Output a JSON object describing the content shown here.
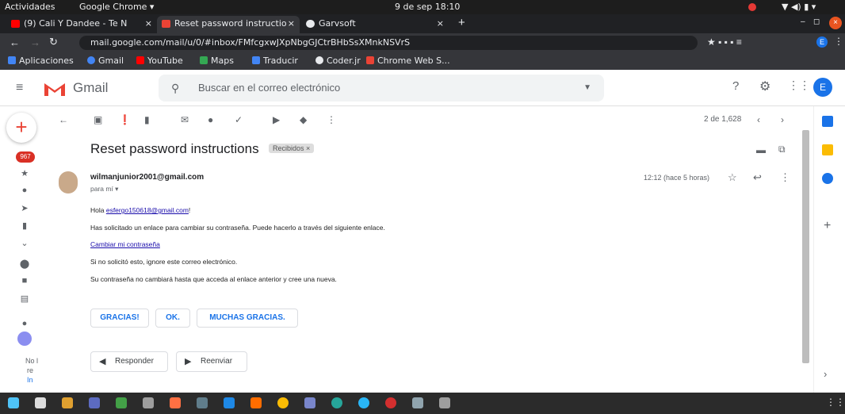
{
  "topbar": {
    "activities": "Actividades",
    "app": "Google Chrome ▾",
    "clock": "9 de sep  18:10"
  },
  "tabs": [
    {
      "title": "(9) Cali Y Dandee - Te N",
      "fav": "#ff0000"
    },
    {
      "title": "Reset password instructio",
      "fav": "#ea4335"
    },
    {
      "title": "Garvsoft",
      "fav": "#e8eaed"
    }
  ],
  "url": "mail.google.com/mail/u/0/#inbox/FMfcgxwJXpNbgGJCtrBHbSsXMnkNSVrS",
  "bookmarks": [
    "Aplicaciones",
    "Gmail",
    "YouTube",
    "Maps",
    "Traducir",
    "Coder.jr",
    "Chrome Web S..."
  ],
  "gmail": {
    "logo": "Gmail",
    "search_placeholder": "Buscar en el correo electrónico",
    "avatar": "E",
    "badge": "967"
  },
  "pager": "2 de 1,628",
  "subject": "Reset password instructions",
  "label": "Recibidos ×",
  "sender": "wilmanjunior2001@gmail.com",
  "to": "para mí ▾",
  "time": "12:12 (hace 5 horas)",
  "body": {
    "greeting": "Hola ",
    "greeting_email": "esfergo150618@gmail.com",
    "greeting_end": "!",
    "line1": "Has solicitado un enlace para cambiar su contraseña. Puede hacerlo a través del siguiente enlace.",
    "link": "Cambiar mi contraseña",
    "line2": "Si no solicitó esto, ignore este correo electrónico.",
    "line3": "Su contraseña no cambiará hasta que acceda al enlace anterior y cree una nueva."
  },
  "smart_replies": [
    "GRACIAS!",
    "OK.",
    "MUCHAS GRACIAS."
  ],
  "reply_label": "Responder",
  "forward_label": "Reenviar",
  "left_partial": [
    "No l",
    "re",
    "In"
  ]
}
